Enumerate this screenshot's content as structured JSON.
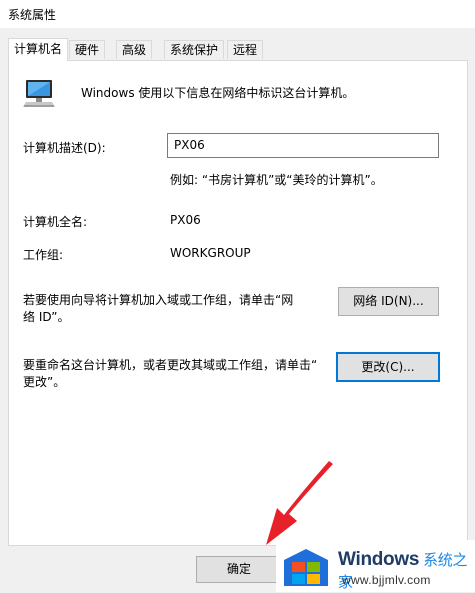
{
  "window": {
    "title": "系统属性"
  },
  "tabs": [
    {
      "label": "计算机名",
      "active": true
    },
    {
      "label": "硬件"
    },
    {
      "label": "高级"
    },
    {
      "label": "系统保护"
    },
    {
      "label": "远程"
    }
  ],
  "computer_name_tab": {
    "intro": "Windows 使用以下信息在网络中标识这台计算机。",
    "description_label": "计算机描述(D):",
    "description_value": "PX06",
    "description_hint": "例如: “书房计算机”或“美玲的计算机”。",
    "full_name_label": "计算机全名:",
    "full_name_value": "PX06",
    "workgroup_label": "工作组:",
    "workgroup_value": "WORKGROUP",
    "network_text_1": "若要使用向导将计算机加入域或工作组，请单击“网",
    "network_text_2": "络 ID”。",
    "network_button": "网络 ID(N)...",
    "rename_text_1": "要重命名这台计算机，或者更改其域或工作组，请单击“",
    "rename_text_2": "更改”。",
    "change_button": "更改(C)..."
  },
  "footer": {
    "ok_button": "确定"
  },
  "watermark": {
    "brand": "Windows",
    "brand_cn": "系统之家",
    "url": "www.bjjmlv.com",
    "arrow_color": "#e8202a"
  }
}
